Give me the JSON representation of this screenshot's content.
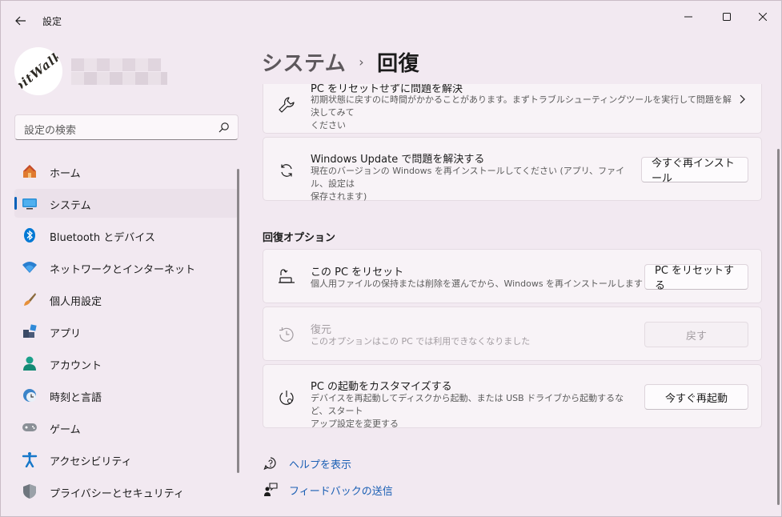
{
  "app": {
    "title": "設定"
  },
  "profile": {
    "avatar_text": "bitWalk"
  },
  "search": {
    "placeholder": "設定の検索"
  },
  "nav": {
    "items": [
      {
        "label": "ホーム",
        "icon": "home-icon"
      },
      {
        "label": "システム",
        "icon": "system-icon",
        "active": true
      },
      {
        "label": "Bluetooth とデバイス",
        "icon": "bluetooth-icon"
      },
      {
        "label": "ネットワークとインターネット",
        "icon": "wifi-icon"
      },
      {
        "label": "個人用設定",
        "icon": "brush-icon"
      },
      {
        "label": "アプリ",
        "icon": "apps-icon"
      },
      {
        "label": "アカウント",
        "icon": "account-icon"
      },
      {
        "label": "時刻と言語",
        "icon": "time-language-icon"
      },
      {
        "label": "ゲーム",
        "icon": "gamepad-icon"
      },
      {
        "label": "アクセシビリティ",
        "icon": "accessibility-icon"
      },
      {
        "label": "プライバシーとセキュリティ",
        "icon": "shield-icon"
      }
    ]
  },
  "breadcrumb": {
    "parent": "システム",
    "separator": "›",
    "current": "回復"
  },
  "cards": {
    "troubleshoot": {
      "title": "PC をリセットせずに問題を解決",
      "desc_line1": "初期状態に戻すのに時間がかかることがあります。まずトラブルシューティングツールを実行して問題を解決してみて",
      "desc_line2": "ください"
    },
    "windows_update": {
      "title": "Windows Update で問題を解決する",
      "desc_line1": "現在のバージョンの Windows を再インストールしてください (アプリ、ファイル、設定は",
      "desc_line2": "保存されます)",
      "button": "今すぐ再インストール"
    }
  },
  "recovery_options": {
    "section_title": "回復オプション",
    "reset": {
      "title": "この PC をリセット",
      "desc": "個人用ファイルの保持または削除を選んでから、Windows を再インストールします",
      "button": "PC をリセットする"
    },
    "go_back": {
      "title": "復元",
      "desc": "このオプションはこの PC では利用できなくなりました",
      "button": "戻す"
    },
    "advanced_startup": {
      "title": "PC の起動をカスタマイズする",
      "desc_line1": "デバイスを再起動してディスクから起動、または USB ドライブから起動するなど、スタート",
      "desc_line2": "アップ設定を変更する",
      "button": "今すぐ再起動"
    }
  },
  "links": {
    "help": "ヘルプを表示",
    "feedback": "フィードバックの送信"
  },
  "colors": {
    "accent": "#005fb8",
    "link": "#1a5fb4",
    "background": "#f2e9f1"
  }
}
